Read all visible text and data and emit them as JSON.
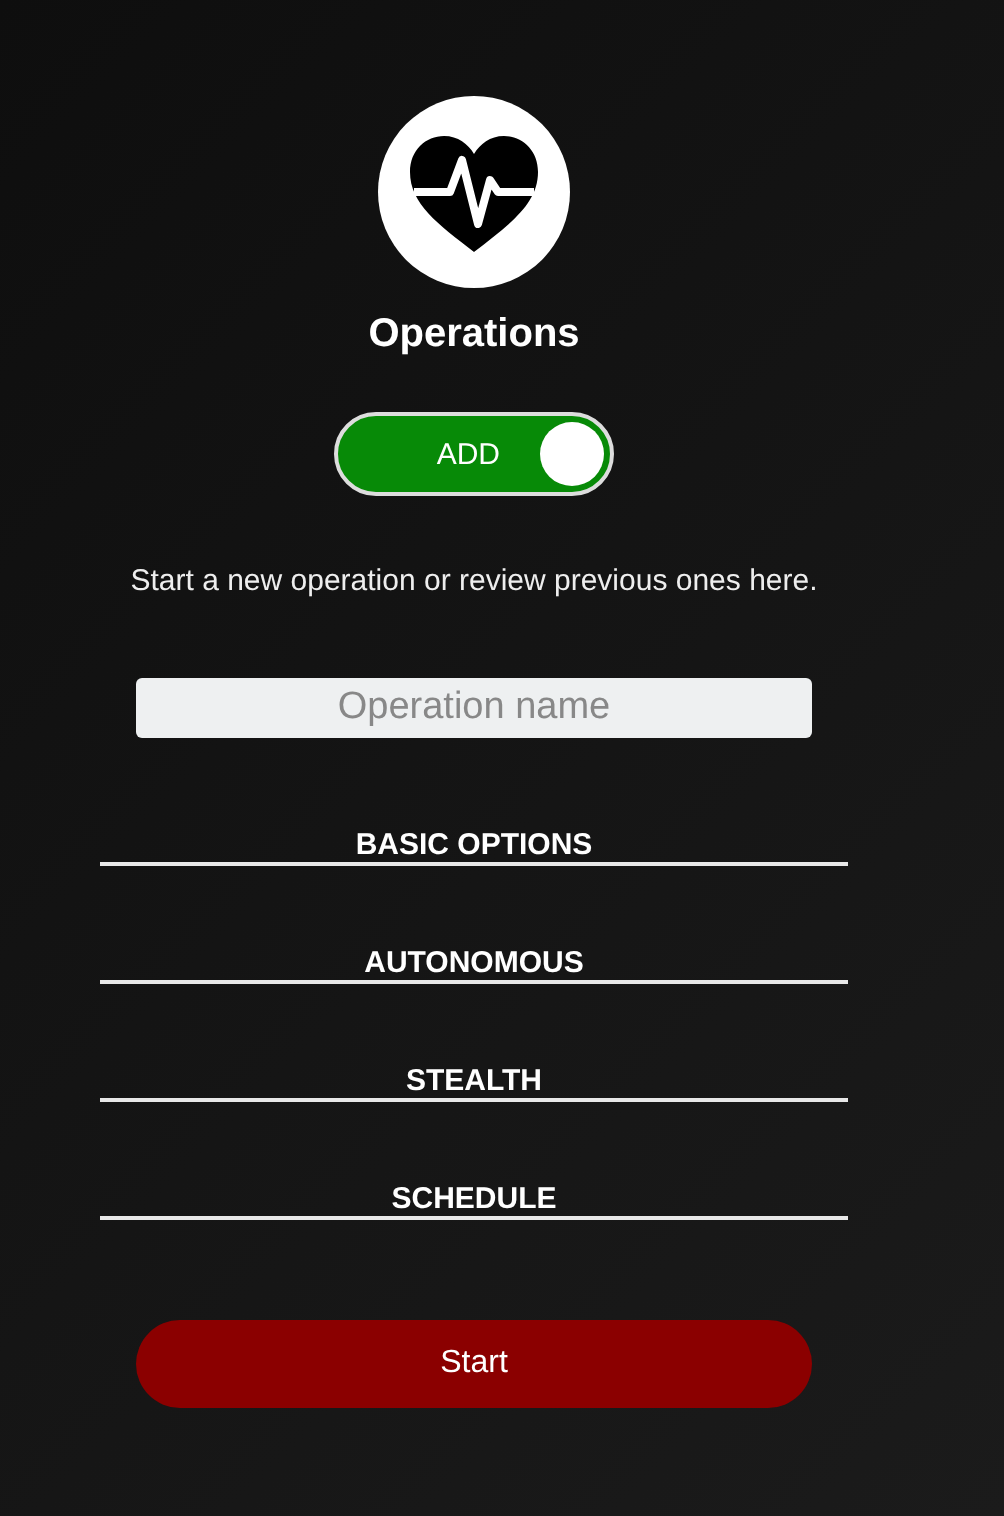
{
  "title": "Operations",
  "mode_toggle": {
    "label": "ADD",
    "on": true
  },
  "description": "Start a new operation or review previous ones here.",
  "name_field": {
    "placeholder": "Operation name"
  },
  "sections": [
    {
      "label": "BASIC OPTIONS"
    },
    {
      "label": "AUTONOMOUS"
    },
    {
      "label": "STEALTH"
    },
    {
      "label": "SCHEDULE"
    }
  ],
  "start_button": {
    "label": "Start"
  }
}
